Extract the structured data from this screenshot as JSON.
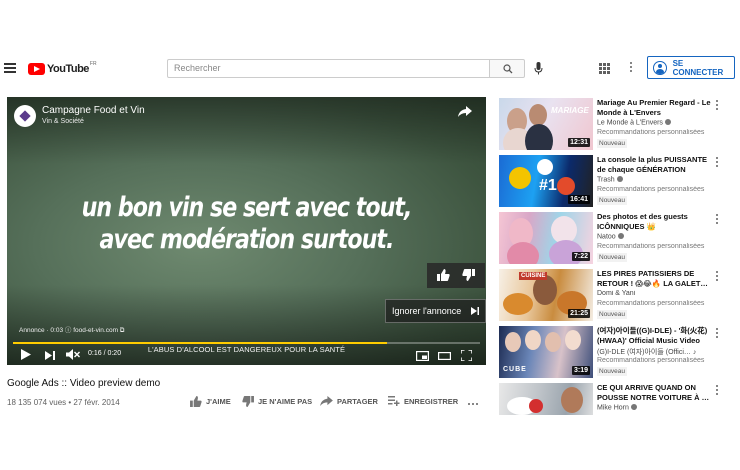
{
  "header": {
    "logo_text": "YouTube",
    "logo_region": "FR",
    "search_placeholder": "Rechercher",
    "signin_label": "SE CONNECTER"
  },
  "player": {
    "ad_title": "Campagne Food et Vin",
    "ad_subtitle": "Vin & Société",
    "slogan_line1": "un bon vin se sert avec tout,",
    "slogan_line2": "avec modération surtout.",
    "skip_label": "Ignorer l'annonce",
    "ad_info": "Annonce · 0:03 ⓘ   food-et-vin.com ⧉",
    "warning": "L'ABUS D'ALCOOL EST DANGEREUX POUR LA SANTÉ",
    "time": "0:16 / 0:20",
    "progress_fraction": 0.8,
    "accent_color": "#ffcc00"
  },
  "video": {
    "title": "Google Ads :: Video preview demo",
    "views": "18 135 074 vues • 27 févr. 2014",
    "actions": {
      "like": "J'AIME",
      "dislike": "JE N'AIME PAS",
      "share": "PARTAGER",
      "save": "ENREGISTRER"
    }
  },
  "recommendations": [
    {
      "title": "Mariage Au Premier Regard - Le Monde à L'Envers",
      "channel": "Le Monde à L'Envers",
      "meta": "Recommandations personnalisées",
      "badge": "Nouveau",
      "duration": "12:31"
    },
    {
      "title": "La console la plus PUISSANTE de chaque GÉNÉRATION",
      "channel": "Trash",
      "meta": "Recommandations personnalisées",
      "badge": "Nouveau",
      "duration": "16:41"
    },
    {
      "title": "Des photos et des guests ICÔNNIQUES 👑",
      "channel": "Natoo",
      "meta": "Recommandations personnalisées",
      "badge": "Nouveau",
      "duration": "7:22"
    },
    {
      "title": "LES PIRES PATISSIERS DE RETOUR ! 😱😂🔥 LA GALET…",
      "channel": "Domi & Yani",
      "meta": "Recommandations personnalisées",
      "badge": "Nouveau",
      "duration": "21:25"
    },
    {
      "title": "(여자)아이들((G)I-DLE) - '화(火花)(HWAA)' Official Music Video",
      "channel": "(G)I-DLE (여자)아이들 (Offici… ♪",
      "meta": "Recommandations personnalisées",
      "badge": "Nouveau",
      "duration": "3:19"
    },
    {
      "title": "CE QUI ARRIVE QUAND ON POUSSE NOTRE VOITURE À …",
      "channel": "Mike Horn",
      "meta": "",
      "badge": "",
      "duration": ""
    }
  ]
}
